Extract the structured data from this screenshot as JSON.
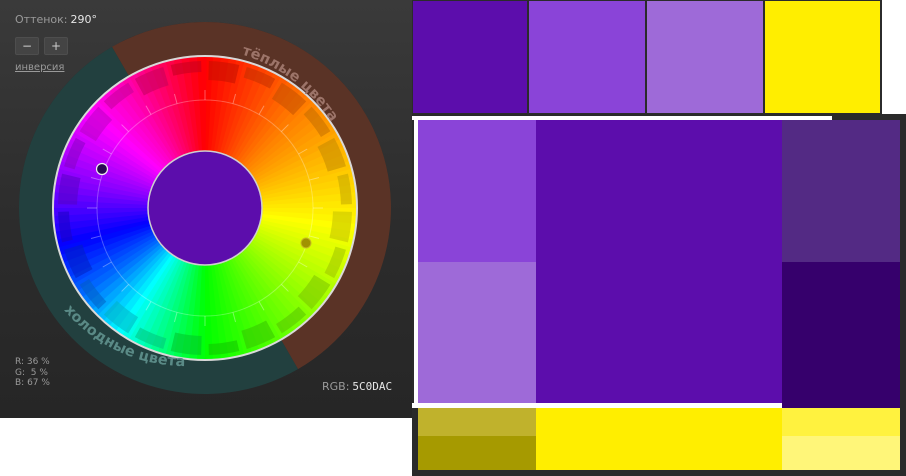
{
  "wheel": {
    "hue_label": "Оттенок:",
    "hue_value": "290°",
    "minus_label": "−",
    "plus_label": "+",
    "invert_label": "инверсия",
    "warm_label": "тёплые цвета",
    "cool_label": "холодные цвета",
    "rgb_breakdown": "R: 36 %\nG:  5 %\nB: 67 %",
    "rgb_label": "RGB:",
    "rgb_value": "5C0DAC",
    "center_color": "#5C0DAC",
    "warm_ring_color": "#5a3326",
    "cool_ring_color": "#22403f"
  },
  "swatches": [
    {
      "name": "base",
      "color": "#5C0DAC"
    },
    {
      "name": "light",
      "color": "#8A44D8"
    },
    {
      "name": "pale",
      "color": "#9E6AD8"
    },
    {
      "name": "complement",
      "color": "#FFEE00"
    }
  ],
  "preview": {
    "cells": [
      {
        "name": "preview-main",
        "color": "#5C0DAC"
      },
      {
        "name": "preview-light-top",
        "color": "#8A44D8"
      },
      {
        "name": "preview-light-bottom",
        "color": "#9E6AD8"
      },
      {
        "name": "preview-dark-top",
        "color": "#532A84"
      },
      {
        "name": "preview-dark-bottom",
        "color": "#36006C"
      },
      {
        "name": "preview-yellow-main",
        "color": "#FFEE00"
      },
      {
        "name": "preview-olive-top",
        "color": "#C0B22C"
      },
      {
        "name": "preview-olive-bottom",
        "color": "#A69A00"
      },
      {
        "name": "preview-yellow-light-top",
        "color": "#FFF23F"
      },
      {
        "name": "preview-yellow-light-bottom",
        "color": "#FFF679"
      }
    ]
  }
}
